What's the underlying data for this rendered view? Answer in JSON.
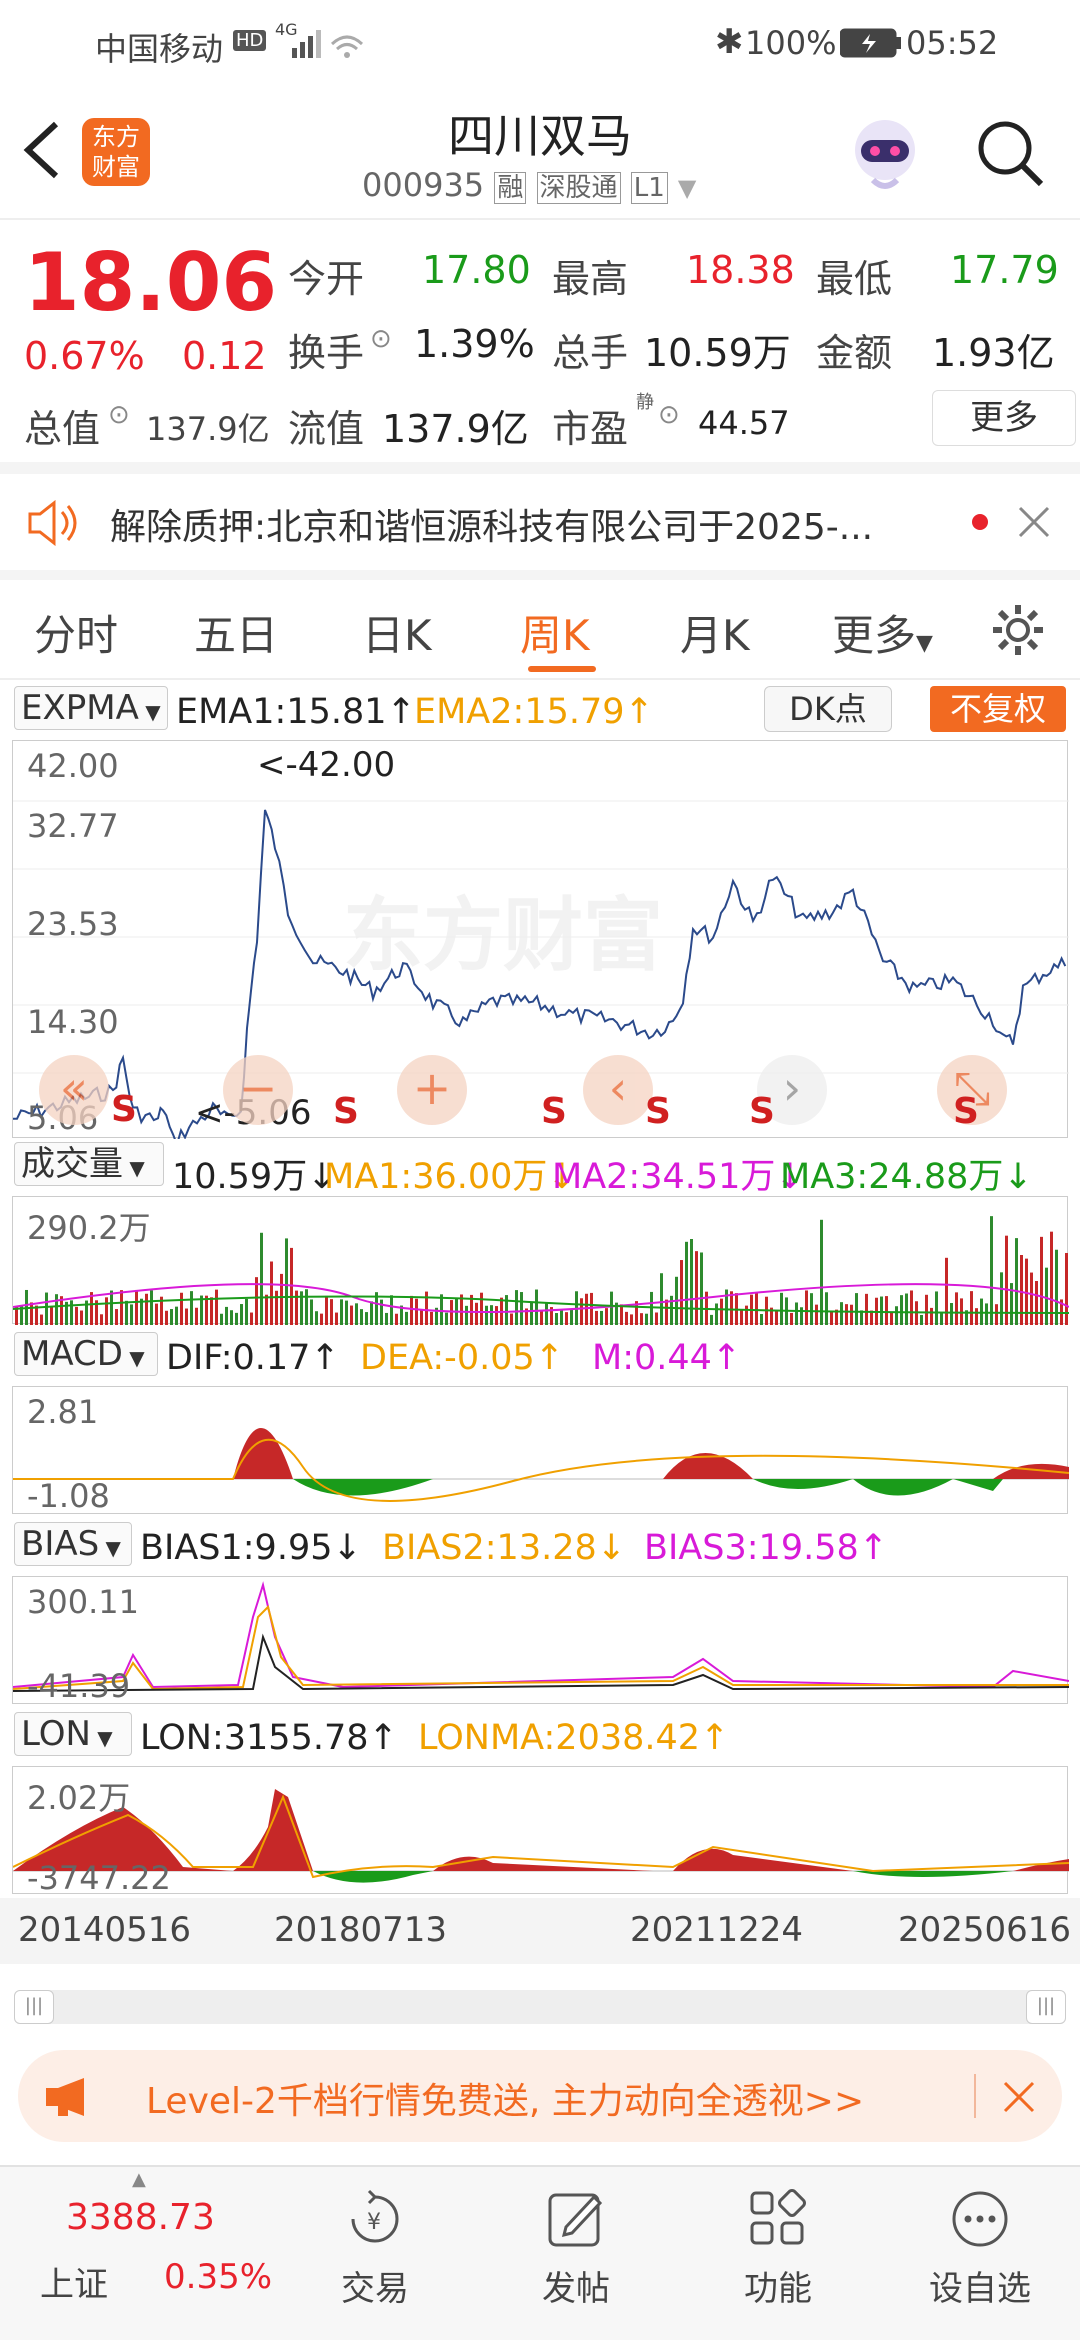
{
  "status_bar": {
    "carrier": "中国移动",
    "hd": "HD",
    "signal": "4G",
    "battery": "100%",
    "time": "05:52"
  },
  "header": {
    "title": "四川双马",
    "code": "000935",
    "tags": [
      "融",
      "深股通",
      "L1"
    ],
    "logo_text_1": "东方",
    "logo_text_2": "财富"
  },
  "quote": {
    "price": "18.06",
    "change_pct": "0.67%",
    "change": "0.12",
    "open_label": "今开",
    "open": "17.80",
    "high_label": "最高",
    "high": "18.38",
    "low_label": "最低",
    "low": "17.79",
    "turnover_label": "换手",
    "turnover": "1.39%",
    "volume_label": "总手",
    "volume": "10.59万",
    "amount_label": "金额",
    "amount": "1.93亿",
    "mktcap_label": "总值",
    "mktcap": "137.9亿",
    "float_label": "流值",
    "float": "137.9亿",
    "pe_label": "市盈",
    "pe_sup": "静",
    "pe": "44.57",
    "more_button": "更多"
  },
  "notice": {
    "label": "解除质押:",
    "text": "北京和谐恒源科技有限公司于2025-..."
  },
  "tabs": [
    "分时",
    "五日",
    "日K",
    "周K",
    "月K",
    "更多"
  ],
  "active_tab": "周K",
  "expma": {
    "name": "EXPMA",
    "ema1": "EMA1:15.81↑",
    "ema2": "EMA2:15.79↑",
    "dk_button": "DK点",
    "adjust_button": "不复权",
    "y_labels": [
      "42.00",
      "32.77",
      "23.53",
      "14.30",
      "5.06"
    ],
    "max_annot": "<-42.00",
    "min_annot": "<-5.06",
    "watermark": "东方财富",
    "signal_letter": "S"
  },
  "volume": {
    "name": "成交量",
    "value": "10.59万↓",
    "ma1": "MA1:36.00万↓",
    "ma2": "MA2:34.51万↓",
    "ma3": "MA3:24.88万↓",
    "y_top": "290.2万"
  },
  "macd": {
    "name": "MACD",
    "dif": "DIF:0.17↑",
    "dea": "DEA:-0.05↑",
    "m": "M:0.44↑",
    "y_top": "2.81",
    "y_bottom": "-1.08"
  },
  "bias": {
    "name": "BIAS",
    "bias1": "BIAS1:9.95↓",
    "bias2": "BIAS2:13.28↓",
    "bias3": "BIAS3:19.58↑",
    "y_top": "300.11",
    "y_bottom": "-41.39"
  },
  "lon": {
    "name": "LON",
    "lon": "LON:3155.78↑",
    "lonma": "LONMA:2038.42↑",
    "y_top": "2.02万",
    "y_bottom": "-3747.22"
  },
  "dates": [
    "20140516",
    "20180713",
    "20211224",
    "20250616"
  ],
  "promo": {
    "text": "Level-2千档行情免费送, 主力动向全透视>>"
  },
  "bottom_nav": {
    "index_value": "3388.73",
    "index_name": "上证",
    "index_pct": "0.35%",
    "items": [
      "交易",
      "发帖",
      "功能",
      "设自选"
    ]
  },
  "colors": {
    "red": "#e8222c",
    "green": "#1a9b1a",
    "accent": "#f26a21"
  }
}
